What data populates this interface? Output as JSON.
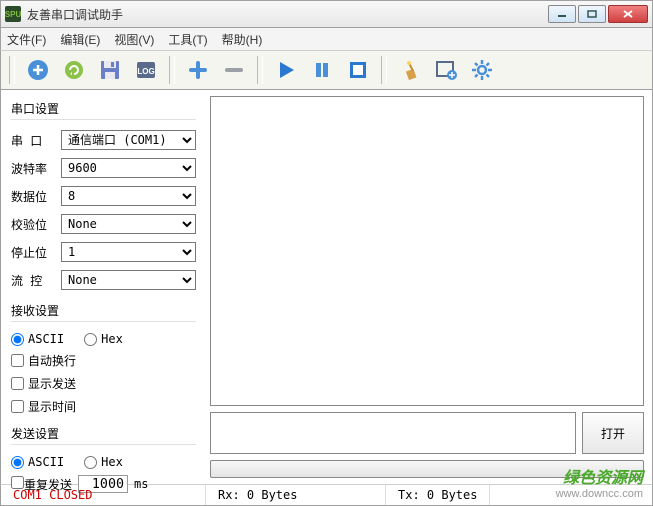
{
  "window": {
    "title": "友善串口调试助手"
  },
  "menu": {
    "file": "文件(F)",
    "edit": "编辑(E)",
    "view": "视图(V)",
    "tools": "工具(T)",
    "help": "帮助(H)"
  },
  "serial": {
    "section": "串口设置",
    "port_label": "串  口",
    "port_value": "通信端口 (COM1)",
    "baud_label": "波特率",
    "baud_value": "9600",
    "data_label": "数据位",
    "data_value": "8",
    "parity_label": "校验位",
    "parity_value": "None",
    "stop_label": "停止位",
    "stop_value": "1",
    "flow_label": "流  控",
    "flow_value": "None"
  },
  "recv": {
    "section": "接收设置",
    "ascii": "ASCII",
    "hex": "Hex",
    "wrap": "自动换行",
    "showsend": "显示发送",
    "showtime": "显示时间"
  },
  "send": {
    "section": "发送设置",
    "ascii": "ASCII",
    "hex": "Hex",
    "repeat": "重复发送",
    "interval": "1000",
    "unit": "ms"
  },
  "buttons": {
    "open": "打开"
  },
  "status": {
    "port": "COM1 CLOSED",
    "rx": "Rx: 0 Bytes",
    "tx": "Tx: 0 Bytes"
  },
  "watermark": {
    "line1": "绿色资源网",
    "line2": "www.downcc.com"
  }
}
